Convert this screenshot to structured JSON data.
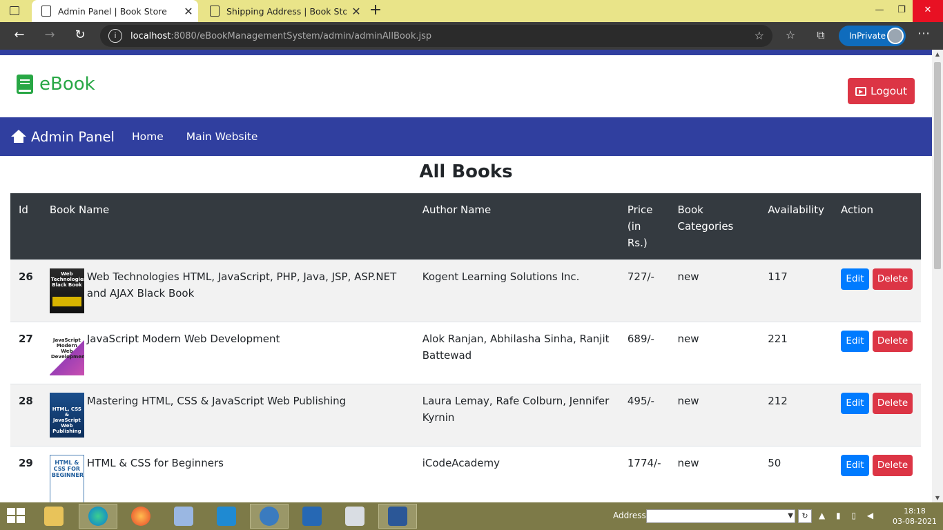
{
  "browser": {
    "tabs": [
      {
        "title": "Admin Panel | Book Store",
        "active": true
      },
      {
        "title": "Shipping Address | Book Store",
        "active": false
      }
    ],
    "address": {
      "host": "localhost",
      "rest": ":8080/eBookManagementSystem/admin/adminAllBook.jsp"
    },
    "inprivate_label": "InPrivate"
  },
  "header": {
    "brand": "eBook",
    "logout_label": "Logout"
  },
  "nav": {
    "brand": "Admin Panel",
    "links": [
      "Home",
      "Main Website"
    ]
  },
  "main": {
    "title": "All Books",
    "columns": [
      "Id",
      "Book Name",
      "Author Name",
      "Price (in Rs.)",
      "Book Categories",
      "Availability",
      "Action"
    ],
    "rows": [
      {
        "id": "26",
        "name": "Web Technologies HTML, JavaScript, PHP, Java, JSP, ASP.NET and AJAX Black Book",
        "author": "Kogent Learning Solutions Inc.",
        "price": "727/-",
        "category": "new",
        "availability": "117",
        "cover_text": "Web Technologies Black Book"
      },
      {
        "id": "27",
        "name": "JavaScript Modern Web Development",
        "author": "Alok Ranjan, Abhilasha Sinha, Ranjit Battewad",
        "price": "689/-",
        "category": "new",
        "availability": "221",
        "cover_text": "JavaScript Modern Web Development"
      },
      {
        "id": "28",
        "name": "Mastering HTML, CSS & JavaScript Web Publishing",
        "author": "Laura Lemay, Rafe Colburn, Jennifer Kyrnin",
        "price": "495/-",
        "category": "new",
        "availability": "212",
        "cover_text": "HTML, CSS & JavaScript Web Publishing"
      },
      {
        "id": "29",
        "name": "HTML & CSS for Beginners",
        "author": "iCodeAcademy",
        "price": "1774/-",
        "category": "new",
        "availability": "50",
        "cover_text": "HTML & CSS FOR BEGINNERS"
      }
    ],
    "edit_label": "Edit",
    "delete_label": "Delete"
  },
  "taskbar": {
    "address_label": "Address",
    "time": "18:18",
    "date": "03-08-2021"
  },
  "colors": {
    "navbar": "#303f9f",
    "brand_green": "#28a745",
    "danger": "#dc3545",
    "primary": "#007bff",
    "table_head": "#343a40"
  }
}
